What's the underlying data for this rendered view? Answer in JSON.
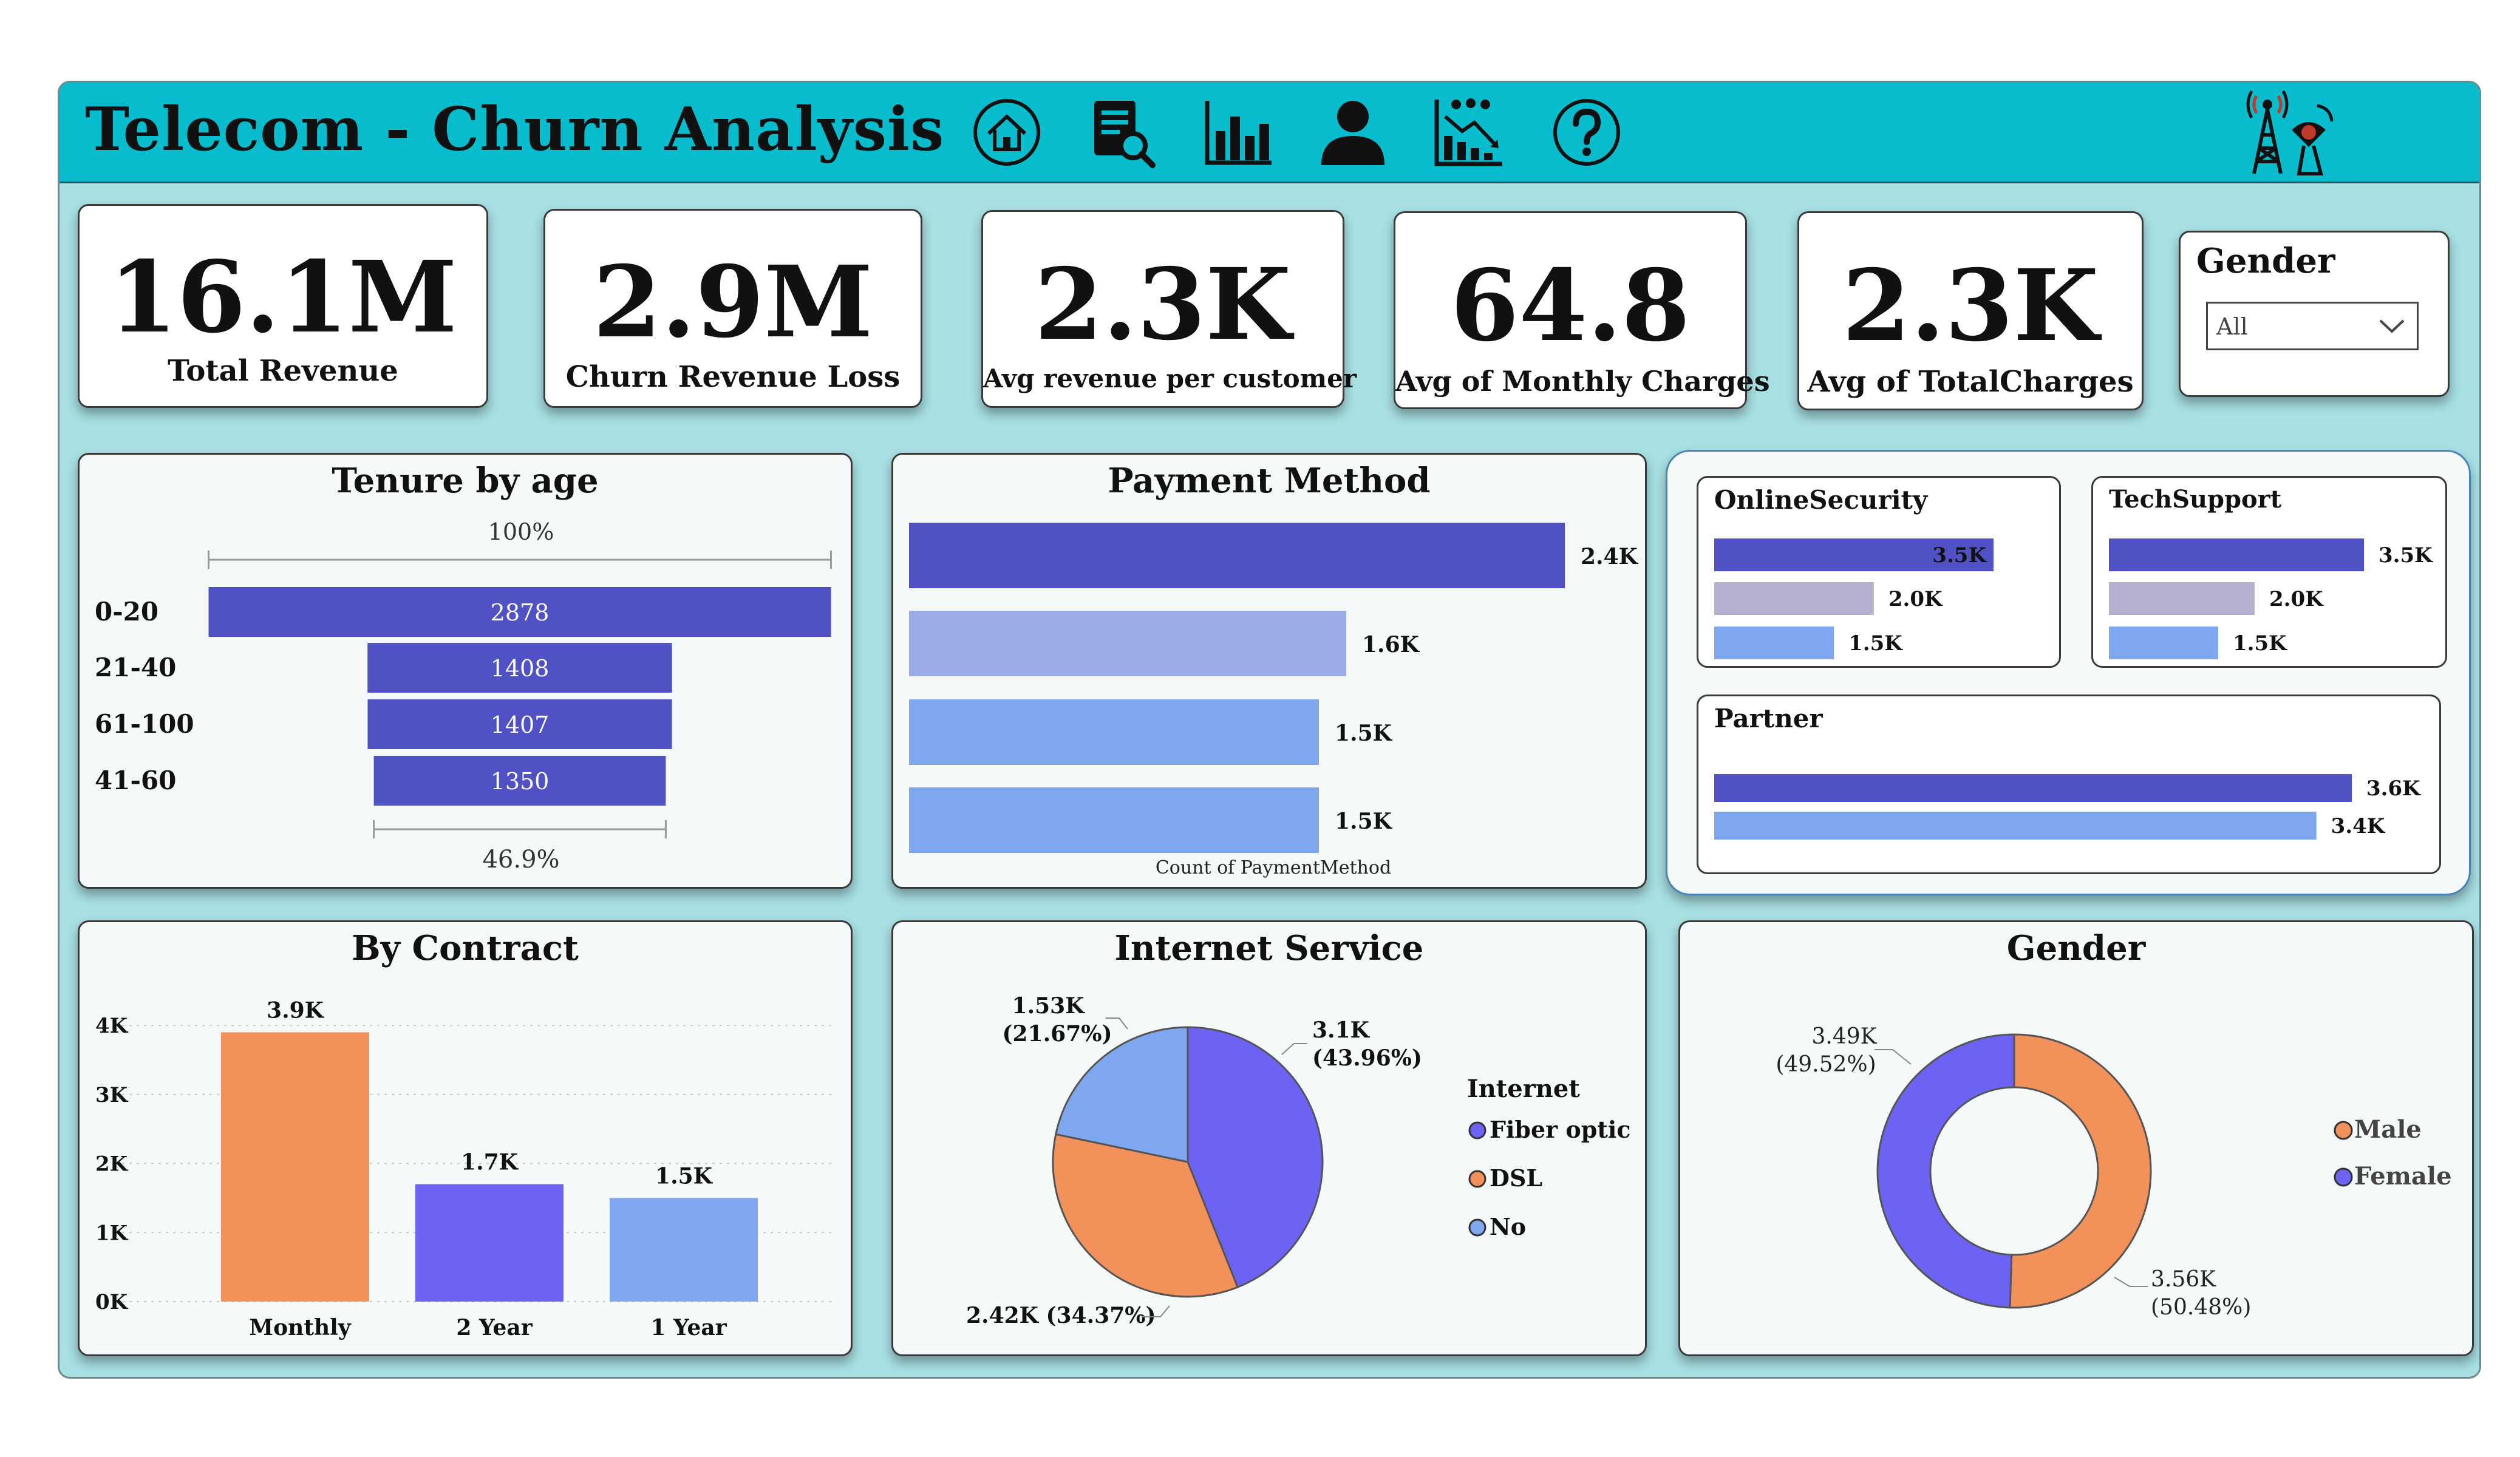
{
  "header": {
    "title": "Telecom - Churn Analysis",
    "nav_icons": [
      "home-icon",
      "report-search-icon",
      "bar-chart-icon",
      "user-icon",
      "decline-chart-icon",
      "help-icon"
    ],
    "logo_icon": "telecom-tower-icon"
  },
  "kpis": [
    {
      "value": "16.1M",
      "label": "Total Revenue"
    },
    {
      "value": "2.9M",
      "label": "Churn Revenue Loss"
    },
    {
      "value": "2.3K",
      "label": "Avg revenue per customer"
    },
    {
      "value": "64.8",
      "label": "Avg of Monthly Charges"
    },
    {
      "value": "2.3K",
      "label": "Avg of TotalCharges"
    }
  ],
  "gender_slicer": {
    "label": "Gender",
    "selected": "All"
  },
  "colors": {
    "header": "#07bccc",
    "background": "#a8e0e3",
    "indigo": "#5151c6",
    "purple": "#6c63f4",
    "orange": "#f2915a",
    "light_blue": "#7fa7f0",
    "lavender": "#9aabe6",
    "grey_purple": "#b3b0d0"
  },
  "charts": {
    "tenure": {
      "title": "Tenure by age",
      "top_pct": "100%",
      "bottom_pct": "46.9%"
    },
    "payment": {
      "title": "Payment Method",
      "axis_label": "Count of PaymentMethod"
    },
    "online_security": {
      "title": "OnlineSecurity"
    },
    "tech_support": {
      "title": "TechSupport"
    },
    "partner": {
      "title": "Partner"
    },
    "contract": {
      "title": "By Contract"
    },
    "internet": {
      "title": "Internet Service",
      "legend_title": "Internet"
    },
    "gender": {
      "title": "Gender"
    }
  },
  "chart_data": [
    {
      "type": "bar",
      "orientation": "horizontal-funnel",
      "title": "Tenure by age",
      "categories": [
        "0-20",
        "21-40",
        "61-100",
        "41-60"
      ],
      "values": [
        2878,
        1408,
        1407,
        1350
      ],
      "labels": [
        "2878",
        "1408",
        "1407",
        "1350"
      ]
    },
    {
      "type": "bar",
      "orientation": "horizontal",
      "title": "Payment Method",
      "xlabel": "Count of PaymentMethod",
      "values": [
        2400,
        1600,
        1500,
        1500
      ],
      "labels": [
        "2.4K",
        "1.6K",
        "1.5K",
        "1.5K"
      ],
      "colors": [
        "#5151c6",
        "#9aabe6",
        "#7fa7f0",
        "#7fa7f0"
      ]
    },
    {
      "type": "bar",
      "orientation": "horizontal",
      "title": "OnlineSecurity",
      "values": [
        3500,
        2000,
        1500
      ],
      "labels": [
        "3.5K",
        "2.0K",
        "1.5K"
      ],
      "colors": [
        "#5151c6",
        "#b3b0d0",
        "#7fa7f0"
      ]
    },
    {
      "type": "bar",
      "orientation": "horizontal",
      "title": "TechSupport",
      "values": [
        3500,
        2000,
        1500
      ],
      "labels": [
        "3.5K",
        "2.0K",
        "1.5K"
      ],
      "colors": [
        "#5151c6",
        "#b3b0d0",
        "#7fa7f0"
      ]
    },
    {
      "type": "bar",
      "orientation": "horizontal",
      "title": "Partner",
      "values": [
        3600,
        3400
      ],
      "labels": [
        "3.6K",
        "3.4K"
      ],
      "colors": [
        "#5151c6",
        "#7fa7f0"
      ]
    },
    {
      "type": "bar",
      "title": "By Contract",
      "categories": [
        "Monthly",
        "2 Year",
        "1 Year"
      ],
      "values": [
        3900,
        1700,
        1500
      ],
      "labels": [
        "3.9K",
        "1.7K",
        "1.5K"
      ],
      "yticks": [
        "0K",
        "1K",
        "2K",
        "3K",
        "4K"
      ],
      "ylim": [
        0,
        4000
      ],
      "colors": [
        "#f2915a",
        "#6c63f4",
        "#7fa7f0"
      ],
      "grid": true
    },
    {
      "type": "pie",
      "title": "Internet Service",
      "legend_title": "Internet",
      "categories": [
        "Fiber optic",
        "DSL",
        "No"
      ],
      "values": [
        3100,
        2420,
        1530
      ],
      "percents": [
        43.96,
        34.37,
        21.67
      ],
      "labels": [
        "3.1K (43.96%)",
        "2.42K (34.37%)",
        "1.53K (21.67%)"
      ],
      "colors": [
        "#6c63f4",
        "#f2915a",
        "#7fa7f0"
      ]
    },
    {
      "type": "pie",
      "variant": "donut",
      "title": "Gender",
      "categories": [
        "Male",
        "Female"
      ],
      "values": [
        3560,
        3490
      ],
      "percents": [
        50.48,
        49.52
      ],
      "labels": [
        "3.56K (50.48%)",
        "3.49K (49.52%)"
      ],
      "colors": [
        "#f2915a",
        "#6c63f4"
      ]
    }
  ]
}
